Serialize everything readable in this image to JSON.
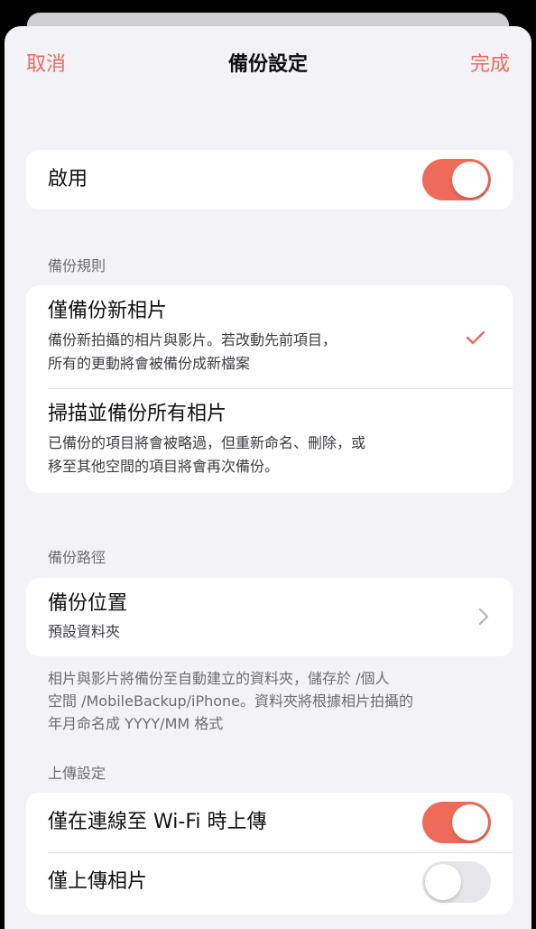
{
  "colors": {
    "accent": "#f06a5a",
    "background": "#f2f2f7"
  },
  "nav": {
    "cancel_label": "取消",
    "title": "備份設定",
    "done_label": "完成"
  },
  "enable": {
    "label": "啟用",
    "toggle_on": true
  },
  "backup_rule": {
    "header": "備份規則",
    "options": [
      {
        "title": "僅備份新相片",
        "desc_line1": "備份新拍攝的相片與影片。若改動先前項目，",
        "desc_line2": "所有的更動將會被備份成新檔案",
        "selected": true
      },
      {
        "title": "掃描並備份所有相片",
        "desc_line1": "已備份的項目將會被略過，但重新命名、刪除，或",
        "desc_line2": "移至其他空間的項目將會再次備份。",
        "selected": false
      }
    ],
    "check_icon": "checkmark-icon"
  },
  "backup_path": {
    "header": "備份路徑",
    "location_title": "備份位置",
    "location_value": "預設資料夾",
    "chevron_icon": "chevron-right-icon",
    "footnote_line1": "相片與影片將備份至自動建立的資料夾，儲存於 /個人",
    "footnote_line2": "空間 /MobileBackup/iPhone。資料夾將根據相片拍攝的",
    "footnote_line3": "年月命名成 YYYY/MM 格式"
  },
  "upload": {
    "header": "上傳設定",
    "wifi_label": "僅在連線至 Wi-Fi 時上傳",
    "wifi_on": true,
    "photos_only_label": "僅上傳相片",
    "photos_only_on": false
  }
}
